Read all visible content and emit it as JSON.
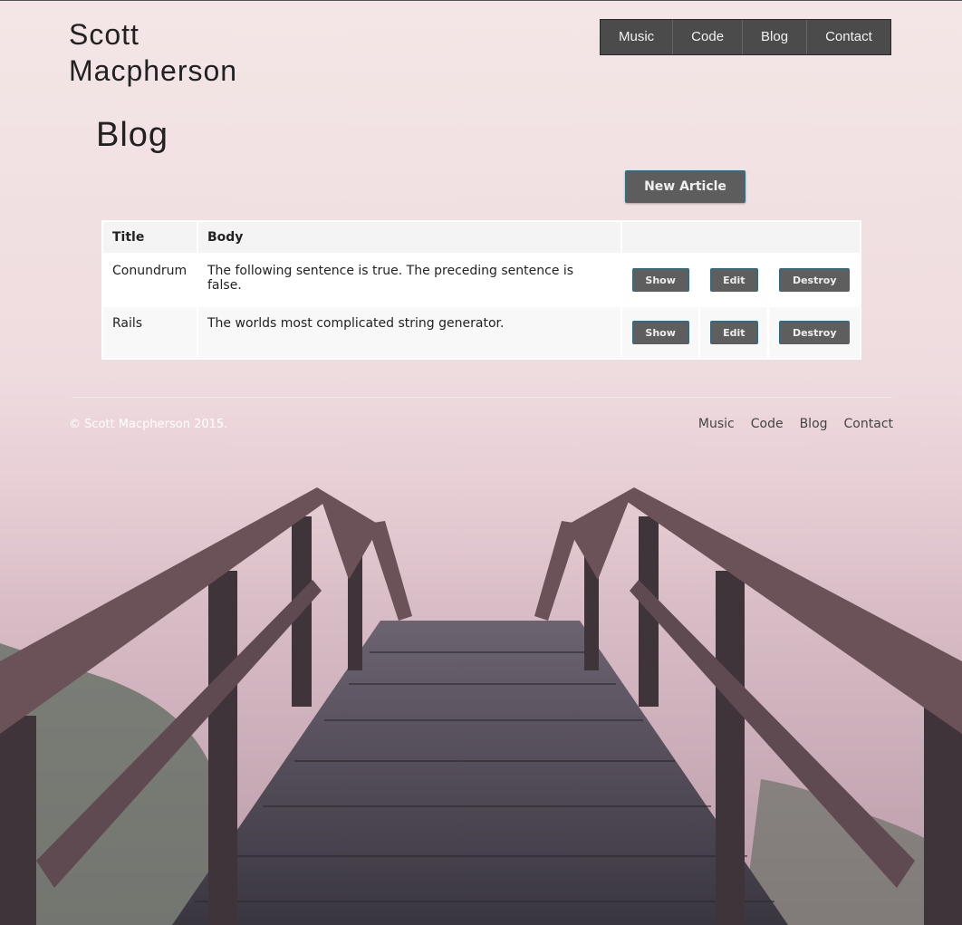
{
  "site": {
    "title": "Scott Macpherson"
  },
  "nav": {
    "items": [
      {
        "label": "Music"
      },
      {
        "label": "Code"
      },
      {
        "label": "Blog"
      },
      {
        "label": "Contact"
      }
    ]
  },
  "page": {
    "heading": "Blog",
    "new_article_label": "New Article"
  },
  "table": {
    "headers": {
      "title": "Title",
      "body": "Body"
    },
    "rows": [
      {
        "title": "Conundrum",
        "body": "The following sentence is true. The preceding sentence is false.",
        "show": "Show",
        "edit": "Edit",
        "destroy": "Destroy"
      },
      {
        "title": "Rails",
        "body": "The worlds most complicated string generator.",
        "show": "Show",
        "edit": "Edit",
        "destroy": "Destroy"
      }
    ]
  },
  "footer": {
    "copyright": "© Scott Macpherson 2015.",
    "links": [
      {
        "label": "Music"
      },
      {
        "label": "Code"
      },
      {
        "label": "Blog"
      },
      {
        "label": "Contact"
      }
    ]
  },
  "colors": {
    "nav_bg": "#4b4b4b",
    "button_bg": "#5e5e5e",
    "button_border": "#2e6b80"
  }
}
